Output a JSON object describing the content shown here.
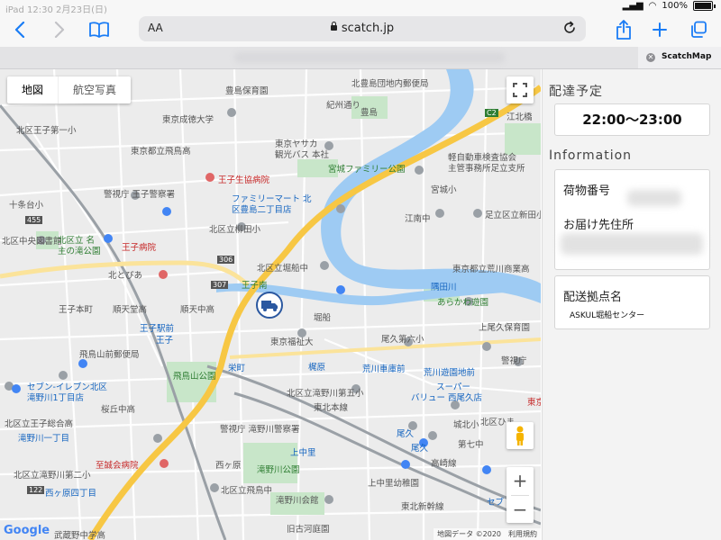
{
  "status_bar": {
    "left_text": "iPad 12:30 2月23日(日)",
    "battery": "100%"
  },
  "browser": {
    "text_size_label": "AA",
    "url": "scatch.jp",
    "tab_title": "ScatchMap"
  },
  "map": {
    "type_buttons": {
      "map": "地図",
      "satellite": "航空写真"
    },
    "zoom_in": "+",
    "zoom_out": "−",
    "logo": "Google",
    "attribution": {
      "data": "地図データ ©2020",
      "terms": "利用規約"
    },
    "labels": [
      "豊島保育園",
      "北豊島団地内郵便局",
      "江北橋",
      "東京成徳大学",
      "紀州通り",
      "豊島",
      "北区王子第一小",
      "東京都立飛鳥高",
      "東京ヤサカ",
      "観光バス 本社",
      "軽自動車検査協会",
      "主管事務所足立支所",
      "宮城ファミリー公園",
      "王子生協病院",
      "ファミリーマート 北",
      "区豊島二丁目店",
      "十条台小",
      "警視庁 王子警察署",
      "宮城小",
      "北区立柳田小",
      "江南中",
      "足立区立新田小",
      "北区中央図書館",
      "北区立 名",
      "主の滝公園",
      "王子病院",
      "北とぴあ",
      "北区立堀船中",
      "東京都立荒川商業高",
      "隅田川",
      "王子南",
      "あらかわ遊園",
      "王子本町",
      "順天堂高",
      "順天中高",
      "王子駅前",
      "王子",
      "堀船",
      "東京福祉大",
      "尾久第六小",
      "上尾久保育園",
      "飛鳥山前郵便局",
      "飛鳥山公園",
      "栄町",
      "梶原",
      "荒川車庫前",
      "荒川遊園地前",
      "警視庁",
      "セブン-イレブン北区",
      "滝野川1丁目店",
      "北区立滝野川第五小",
      "東北本線",
      "スーパー",
      "バリュー 西尾久店",
      "桜丘中高",
      "東京",
      "北区立王子総合高",
      "滝野川一丁目",
      "警視庁 滝野川警察署",
      "北区ひま",
      "城北小",
      "尾久",
      "第七中",
      "至誠会病院",
      "上中里",
      "高崎線",
      "滝野川公園",
      "北区立滝野川第二小",
      "西ヶ原四丁目",
      "上中里幼稚園",
      "北区立飛鳥中",
      "滝野川会館",
      "旧古河庭園",
      "武蔵野中学高",
      "西ヶ原",
      "東北新幹線",
      "セブ",
      "尾久",
      "455",
      "306",
      "307",
      "122",
      "C2"
    ]
  },
  "panel": {
    "delivery_title": "配達予定",
    "delivery_time": "22:00〜23:00",
    "info_title": "Information",
    "tracking_label": "荷物番号",
    "address_label": "お届け先住所",
    "origin_label": "配送拠点名",
    "origin_value": "ASKUL堀船センター"
  },
  "colors": {
    "map_bg": "#ececec",
    "river": "#9ecbf3",
    "highway": "#f7c744",
    "rail": "#9aa0a6",
    "truck_marker": "#2b58a0",
    "park": "#c8e6c9"
  }
}
